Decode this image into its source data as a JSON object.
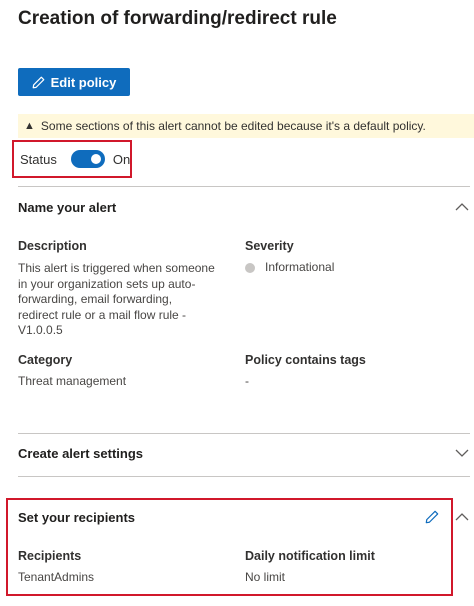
{
  "page": {
    "title": "Creation of forwarding/redirect rule",
    "edit_button_label": "Edit policy",
    "warning_text": "Some sections of this alert cannot be edited because it's a default policy."
  },
  "status": {
    "label": "Status",
    "value": "On",
    "enabled": true
  },
  "sections": {
    "name_alert": {
      "title": "Name your alert",
      "description_label": "Description",
      "description_lines": [
        "This alert is triggered when someone",
        "in your organization sets up auto-",
        "forwarding, email forwarding,",
        "redirect rule or a mail flow rule -",
        "V1.0.0.5"
      ],
      "severity_label": "Severity",
      "severity_value": "Informational",
      "category_label": "Category",
      "category_value": "Threat management",
      "tags_label": "Policy contains tags",
      "tags_value": "-"
    },
    "alert_settings": {
      "title": "Create alert settings"
    },
    "recipients": {
      "title": "Set your recipients",
      "recipients_label": "Recipients",
      "recipients_value": "TenantAdmins",
      "limit_label": "Daily notification limit",
      "limit_value": "No limit"
    }
  },
  "icons": {
    "edit": "pencil-icon",
    "warning": "warning-icon",
    "collapse": "chevron-up-icon",
    "expand": "chevron-down-icon"
  },
  "colors": {
    "accent": "#0f6cbd",
    "highlight_border": "#d1182b",
    "warning_bg": "#fff8dc"
  }
}
